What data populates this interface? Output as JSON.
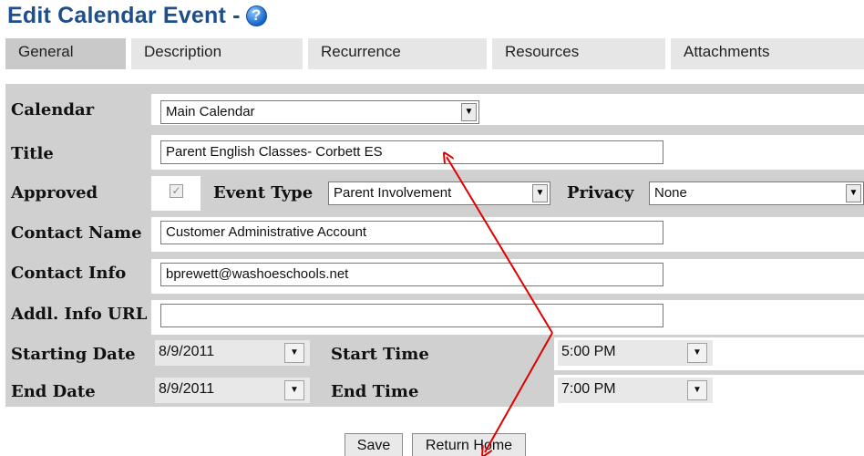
{
  "page": {
    "title": "Edit Calendar Event -",
    "help_glyph": "?"
  },
  "tabs": [
    {
      "label": "General",
      "active": true
    },
    {
      "label": "Description",
      "active": false
    },
    {
      "label": "Recurrence",
      "active": false
    },
    {
      "label": "Resources",
      "active": false
    },
    {
      "label": "Attachments",
      "active": false
    }
  ],
  "form": {
    "calendar": {
      "label": "Calendar",
      "value": "Main Calendar"
    },
    "title": {
      "label": "Title",
      "value": "Parent English Classes- Corbett ES"
    },
    "approved": {
      "label": "Approved",
      "checked": true,
      "check_glyph": "✓"
    },
    "event_type": {
      "label": "Event Type",
      "value": "Parent Involvement"
    },
    "privacy": {
      "label": "Privacy",
      "value": "None"
    },
    "contact_name": {
      "label": "Contact Name",
      "value": "Customer Administrative Account"
    },
    "contact_info": {
      "label": "Contact Info",
      "value": "bprewett@washoeschools.net"
    },
    "addl_info_url": {
      "label": "Addl. Info URL",
      "value": ""
    },
    "starting_date": {
      "label": "Starting Date",
      "value": "8/9/2011"
    },
    "start_time": {
      "label": "Start Time",
      "value": "5:00 PM"
    },
    "end_date": {
      "label": "End Date",
      "value": "8/9/2011"
    },
    "end_time": {
      "label": "End Time",
      "value": "7:00 PM"
    }
  },
  "icons": {
    "dropdown_arrow": "▼"
  },
  "buttons": {
    "save": "Save",
    "return_home": "Return Home"
  },
  "colors": {
    "title": "#1f4e8c",
    "panel": "#d0d0d0",
    "annotation_arrow": "#e00000"
  }
}
